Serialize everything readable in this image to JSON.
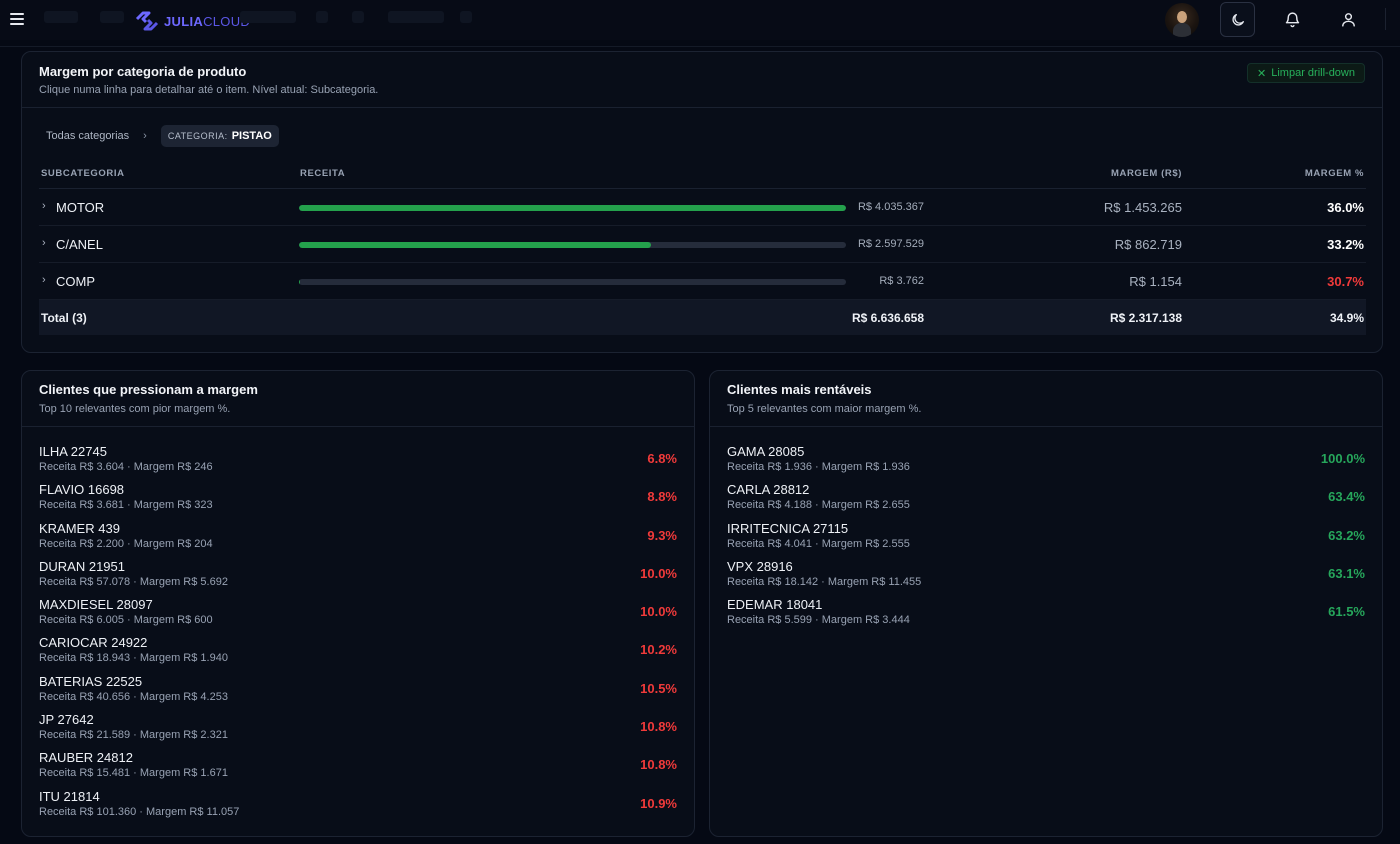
{
  "topbar": {
    "logo": {
      "part1": "JULIA",
      "part2": "CLOUD"
    },
    "icons": {
      "menu": "hamburger-icon",
      "logo": "julia-logo-icon",
      "theme": "moon-icon",
      "notifications": "bell-icon",
      "user": "user-icon"
    }
  },
  "margin_card": {
    "title": "Margem por categoria de produto",
    "subtitle": "Clique numa linha para detalhar até o item. Nível atual: Subcategoria.",
    "clear_button": "Limpar drill-down",
    "breadcrumb": {
      "root": "Todas categorias",
      "chip_key": "CATEGORIA:",
      "chip_value": "PISTAO"
    },
    "table": {
      "headers": {
        "subcategory": "SUBCATEGORIA",
        "revenue": "RECEITA",
        "margin": "MARGEM (R$)",
        "margin_pct": "MARGEM %"
      },
      "rows": [
        {
          "name": "MOTOR",
          "revenue": "R$ 4.035.367",
          "revenue_share": 1.0,
          "margin": "R$ 1.453.265",
          "margin_pct": "36.0%",
          "pct_color": "#ffffff"
        },
        {
          "name": "C/ANEL",
          "revenue": "R$ 2.597.529",
          "revenue_share": 0.644,
          "margin": "R$ 862.719",
          "margin_pct": "33.2%",
          "pct_color": "#ffffff"
        },
        {
          "name": "COMP",
          "revenue": "R$ 3.762",
          "revenue_share": 0.001,
          "margin": "R$ 1.154",
          "margin_pct": "30.7%",
          "pct_color": "#f03a3a"
        }
      ],
      "total": {
        "label": "Total (3)",
        "revenue": "R$ 6.636.658",
        "margin": "R$ 2.317.138",
        "margin_pct": "34.9%"
      }
    }
  },
  "pressure_card": {
    "title": "Clientes que pressionam a margem",
    "subtitle": "Top 10 relevantes com pior margem %.",
    "items": [
      {
        "name": "ILHA 22745",
        "detail": "Receita R$ 3.604 · Margem R$ 246",
        "pct": "6.8%"
      },
      {
        "name": "FLAVIO 16698",
        "detail": "Receita R$ 3.681 · Margem R$ 323",
        "pct": "8.8%"
      },
      {
        "name": "KRAMER 439",
        "detail": "Receita R$ 2.200 · Margem R$ 204",
        "pct": "9.3%"
      },
      {
        "name": "DURAN 21951",
        "detail": "Receita R$ 57.078 · Margem R$ 5.692",
        "pct": "10.0%"
      },
      {
        "name": "MAXDIESEL 28097",
        "detail": "Receita R$ 6.005 · Margem R$ 600",
        "pct": "10.0%"
      },
      {
        "name": "CARIOCAR 24922",
        "detail": "Receita R$ 18.943 · Margem R$ 1.940",
        "pct": "10.2%"
      },
      {
        "name": "BATERIAS 22525",
        "detail": "Receita R$ 40.656 · Margem R$ 4.253",
        "pct": "10.5%"
      },
      {
        "name": "JP 27642",
        "detail": "Receita R$ 21.589 · Margem R$ 2.321",
        "pct": "10.8%"
      },
      {
        "name": "RAUBER 24812",
        "detail": "Receita R$ 15.481 · Margem R$ 1.671",
        "pct": "10.8%"
      },
      {
        "name": "ITU 21814",
        "detail": "Receita R$ 101.360 · Margem R$ 11.057",
        "pct": "10.9%"
      }
    ]
  },
  "profitable_card": {
    "title": "Clientes mais rentáveis",
    "subtitle": "Top 5 relevantes com maior margem %.",
    "items": [
      {
        "name": "GAMA 28085",
        "detail": "Receita R$ 1.936 · Margem R$ 1.936",
        "pct": "100.0%"
      },
      {
        "name": "CARLA 28812",
        "detail": "Receita R$ 4.188 · Margem R$ 2.655",
        "pct": "63.4%"
      },
      {
        "name": "IRRITECNICA 27115",
        "detail": "Receita R$ 4.041 · Margem R$ 2.555",
        "pct": "63.2%"
      },
      {
        "name": "VPX 28916",
        "detail": "Receita R$ 18.142 · Margem R$ 11.455",
        "pct": "63.1%"
      },
      {
        "name": "EDEMAR 18041",
        "detail": "Receita R$ 5.599 · Margem R$ 3.444",
        "pct": "61.5%"
      }
    ]
  }
}
